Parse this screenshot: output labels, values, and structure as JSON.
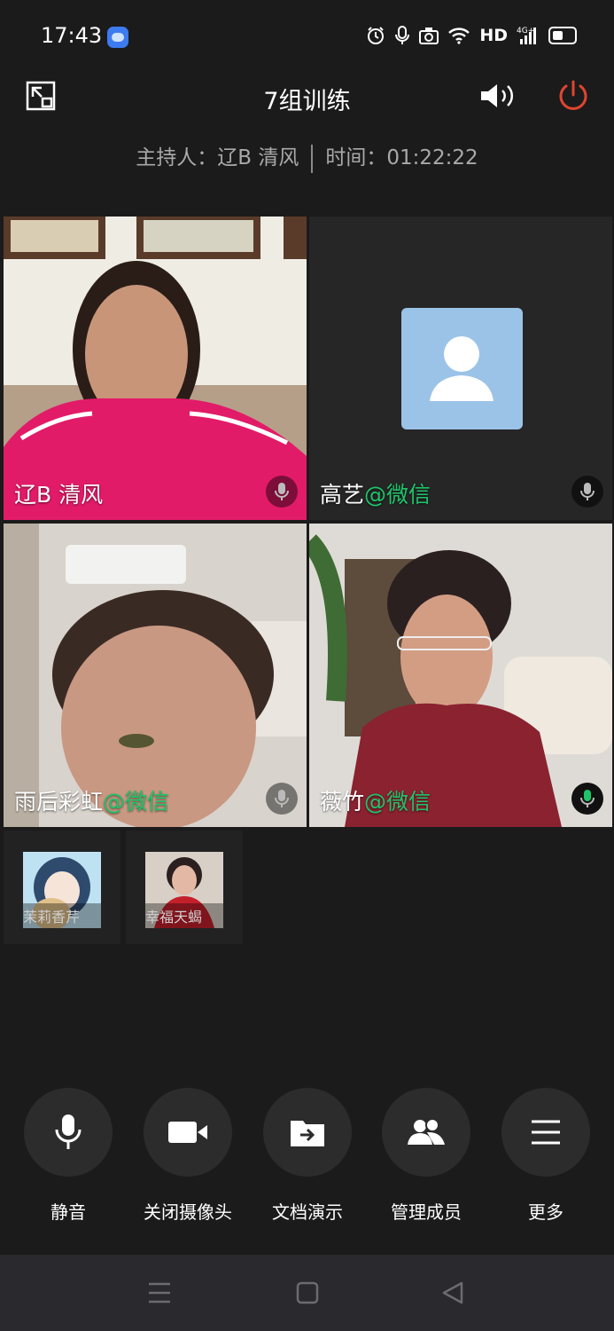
{
  "status_bar": {
    "time": "17:43",
    "network": "HD",
    "icons": [
      "alarm-icon",
      "mic-icon",
      "camera-icon",
      "wifi-icon",
      "signal-icon",
      "battery-icon"
    ]
  },
  "header": {
    "title": "7组训练",
    "host_label": "主持人：辽B 清风",
    "time_label": "时间：01:22:22"
  },
  "participants": [
    {
      "name": "辽B 清风",
      "suffix": ""
    },
    {
      "name": "高艺",
      "suffix": "@微信"
    },
    {
      "name": "雨后彩虹",
      "suffix": "@微信"
    },
    {
      "name": "薇竹",
      "suffix": "@微信"
    }
  ],
  "thumbnails": [
    {
      "name": "茉莉香芹"
    },
    {
      "name": "幸福天蝎"
    }
  ],
  "controls": [
    {
      "label": "静音",
      "icon": "microphone-icon"
    },
    {
      "label": "关闭摄像头",
      "icon": "camera-icon"
    },
    {
      "label": "文档演示",
      "icon": "share-document-icon"
    },
    {
      "label": "管理成员",
      "icon": "members-icon"
    },
    {
      "label": "更多",
      "icon": "menu-icon"
    }
  ],
  "colors": {
    "background": "#1b1b1b",
    "wechat_green": "#1ec46a",
    "leave_red": "#e0452f",
    "avatar_blue": "#9bc3e8"
  }
}
